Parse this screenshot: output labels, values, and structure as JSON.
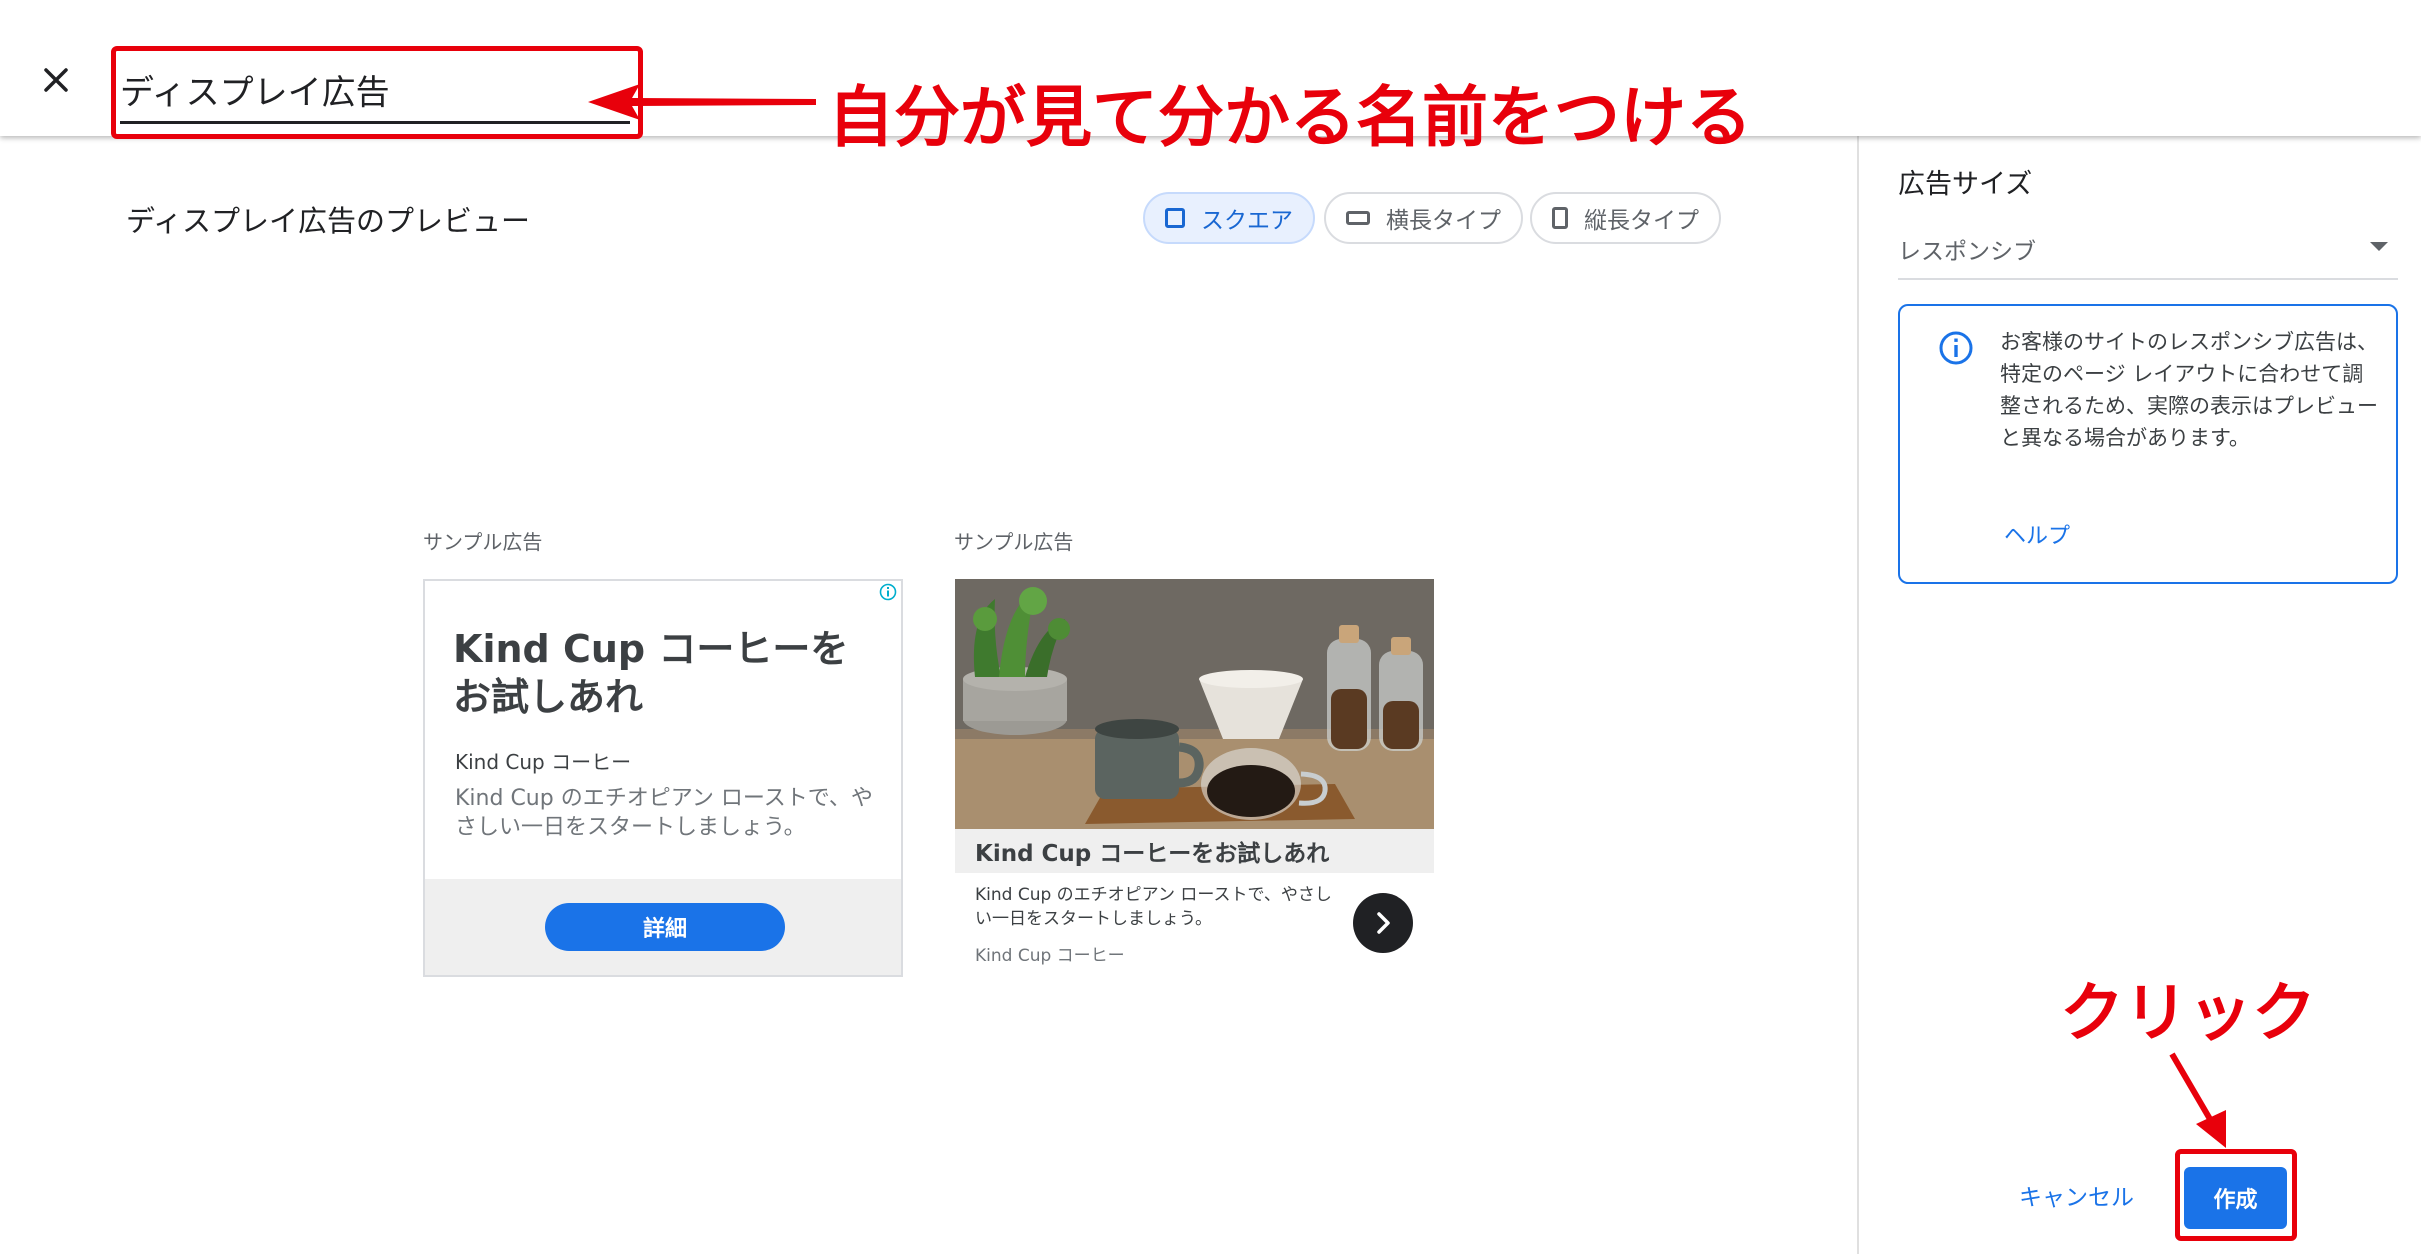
{
  "header": {
    "close_icon": "close-icon",
    "ad_name_value": "ディスプレイ広告"
  },
  "annotations": {
    "name_hint": "自分が見て分かる名前をつける",
    "click_hint": "クリック",
    "color": "#e8000b"
  },
  "preview": {
    "title": "ディスプレイ広告のプレビュー",
    "format_chips": [
      {
        "label": "スクエア",
        "icon": "square-icon",
        "selected": true
      },
      {
        "label": "横長タイプ",
        "icon": "landscape-icon",
        "selected": false
      },
      {
        "label": "縦長タイプ",
        "icon": "portrait-icon",
        "selected": false
      }
    ],
    "sample_label_1": "サンプル広告",
    "sample_label_2": "サンプル広告",
    "ad1": {
      "headline": "Kind Cup コーヒーを お試しあれ",
      "brand": "Kind Cup コーヒー",
      "description": "Kind Cup のエチオピアン ローストで、やさしい一日をスタートしましょう。",
      "cta": "詳細",
      "info_icon": "info-icon"
    },
    "ad2": {
      "headline": "Kind Cup コーヒーをお試しあれ",
      "description": "Kind Cup のエチオピアン ローストで、やさしい一日をスタートしましょう。",
      "brand": "Kind Cup コーヒー",
      "next_icon": "chevron-right-icon"
    }
  },
  "sidebar": {
    "size_title": "広告サイズ",
    "size_value": "レスポンシブ",
    "notice_text": "お客様のサイトのレスポンシブ広告は、特定のページ レイアウトに合わせて調整されるため、実際の表示はプレビューと異なる場合があります。",
    "help_link": "ヘルプ",
    "cancel_label": "キャンセル",
    "create_label": "作成"
  },
  "colors": {
    "accent": "#1a73e8",
    "annotation": "#e8000b"
  }
}
